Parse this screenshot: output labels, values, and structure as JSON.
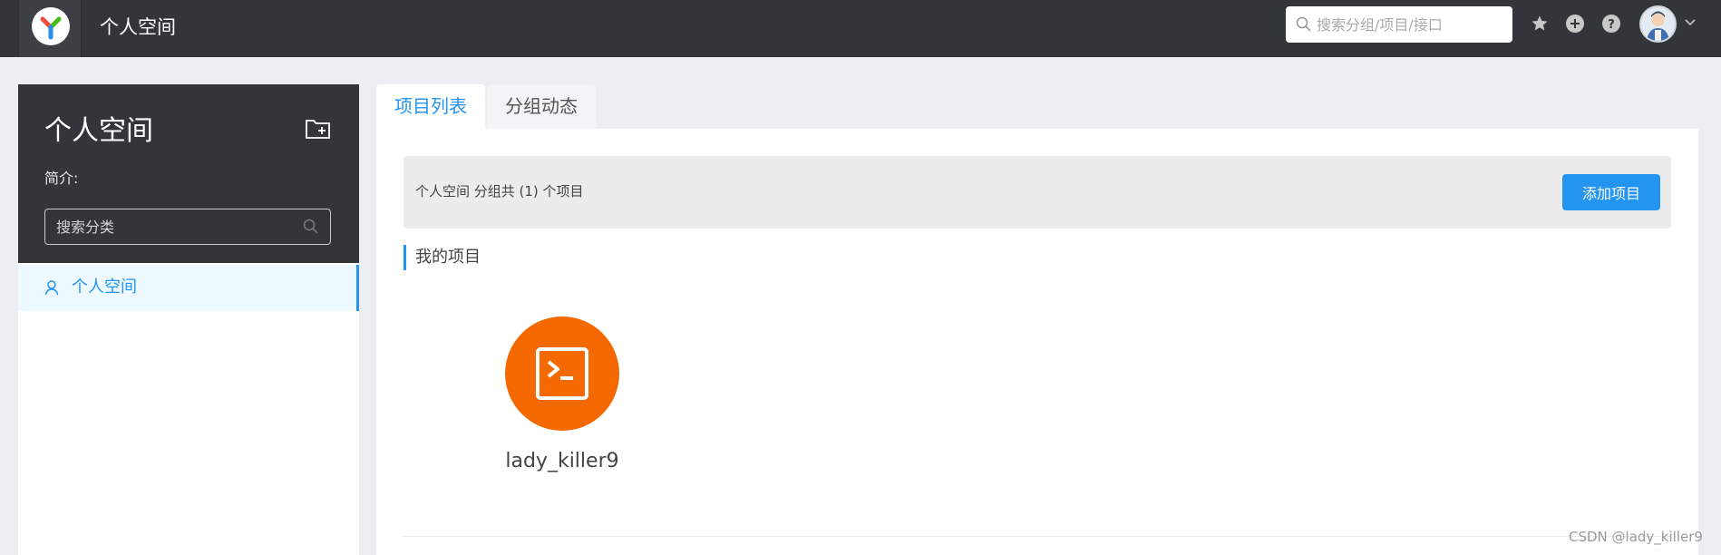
{
  "header": {
    "title": "个人空间",
    "search_placeholder": "搜索分组/项目/接口",
    "icons": [
      "star-icon",
      "plus-circle-icon",
      "help-icon"
    ]
  },
  "sidebar": {
    "title": "个人空间",
    "description_label": "简介:",
    "search_placeholder": "搜索分类",
    "items": [
      {
        "label": "个人空间",
        "icon": "user-icon",
        "active": true
      }
    ]
  },
  "tabs": [
    {
      "label": "项目列表",
      "active": true
    },
    {
      "label": "分组动态",
      "active": false
    }
  ],
  "main": {
    "info_text": "个人空间 分组共 (1) 个项目",
    "add_button_label": "添加项目",
    "section_title": "我的项目",
    "projects": [
      {
        "name": "lady_killer9",
        "icon": "terminal-icon",
        "color": "#f56a00"
      }
    ]
  },
  "watermark": "CSDN @lady_killer9",
  "colors": {
    "accent": "#2395f1",
    "topbar": "#32363a",
    "project_logo": "#f56a00"
  }
}
